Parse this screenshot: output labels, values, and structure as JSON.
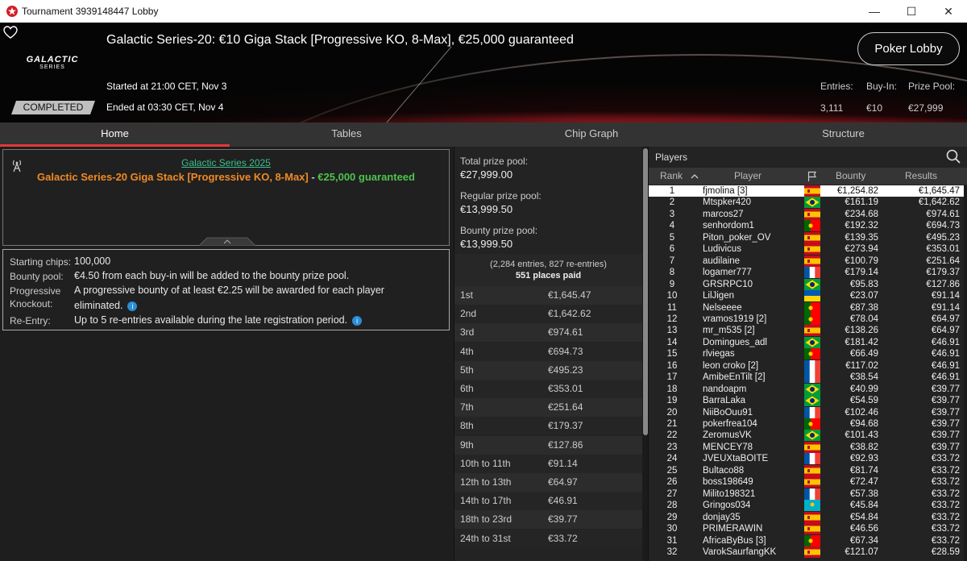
{
  "window": {
    "title": "Tournament 3939148447 Lobby",
    "minimize": "—",
    "maximize": "☐",
    "close": "✕"
  },
  "header": {
    "tournament_name": "Galactic Series-20: €10 Giga Stack [Progressive KO, 8-Max], €25,000 guaranteed",
    "brand_line1": "GALACTIC",
    "brand_line2": "SERIES",
    "status": "COMPLETED",
    "started": "Started at 21:00 CET, Nov 3",
    "ended": "Ended at 03:30 CET, Nov 4",
    "lobby_button": "Poker Lobby",
    "stats": {
      "entries_label": "Entries:",
      "buyin_label": "Buy-In:",
      "prize_label": "Prize Pool:",
      "entries": "3,111",
      "buyin": "€10",
      "prize": "€27,999"
    }
  },
  "tabs": [
    "Home",
    "Tables",
    "Chip Graph",
    "Structure"
  ],
  "info": {
    "series_link": "Galactic Series 2025",
    "event_name": "Galactic Series-20 Giga Stack [Progressive KO, 8-Max]",
    "separator": " - ",
    "guarantee": "€25,000 guaranteed"
  },
  "rules": {
    "starting_chips_label": "Starting chips:",
    "starting_chips": "100,000",
    "bounty_pool_label": "Bounty pool:",
    "bounty_pool": "€4.50 from each buy-in will be added to the bounty prize pool.",
    "pko_label_1": "Progressive",
    "pko_label_2": "Knockout:",
    "pko_1": "A progressive bounty of at least €2.25 will be awarded for each player",
    "pko_2": "eliminated.",
    "reentry_label": "Re-Entry:",
    "reentry": "Up to 5 re-entries available during the late registration period."
  },
  "prizes": {
    "total_label": "Total prize pool:",
    "total": "€27,999.00",
    "regular_label": "Regular prize pool:",
    "regular": "€13,999.50",
    "bounty_label": "Bounty prize pool:",
    "bounty": "€13,999.50",
    "entries_note": "(2,284 entries, 827 re-entries)",
    "places_paid": "551 places paid",
    "rows": [
      {
        "place": "1st",
        "amount": "€1,645.47"
      },
      {
        "place": "2nd",
        "amount": "€1,642.62"
      },
      {
        "place": "3rd",
        "amount": "€974.61"
      },
      {
        "place": "4th",
        "amount": "€694.73"
      },
      {
        "place": "5th",
        "amount": "€495.23"
      },
      {
        "place": "6th",
        "amount": "€353.01"
      },
      {
        "place": "7th",
        "amount": "€251.64"
      },
      {
        "place": "8th",
        "amount": "€179.37"
      },
      {
        "place": "9th",
        "amount": "€127.86"
      },
      {
        "place": "10th to 11th",
        "amount": "€91.14"
      },
      {
        "place": "12th to 13th",
        "amount": "€64.97"
      },
      {
        "place": "14th to 17th",
        "amount": "€46.91"
      },
      {
        "place": "18th to 23rd",
        "amount": "€39.77"
      },
      {
        "place": "24th to 31st",
        "amount": "€33.72"
      }
    ]
  },
  "players": {
    "title": "Players",
    "columns": {
      "rank": "Rank",
      "player": "Player",
      "bounty": "Bounty",
      "results": "Results"
    },
    "rows": [
      {
        "rank": "1",
        "name": "fjmolina [3]",
        "flag": "es",
        "bounty": "€1,254.82",
        "result": "€1,645.47"
      },
      {
        "rank": "2",
        "name": "Mtspker420",
        "flag": "br",
        "bounty": "€161.19",
        "result": "€1,642.62"
      },
      {
        "rank": "3",
        "name": "marcos27",
        "flag": "es",
        "bounty": "€234.68",
        "result": "€974.61"
      },
      {
        "rank": "4",
        "name": "senhordom1",
        "flag": "pt",
        "bounty": "€192.32",
        "result": "€694.73"
      },
      {
        "rank": "5",
        "name": "Piton_poker_OV",
        "flag": "es",
        "bounty": "€139.35",
        "result": "€495.23"
      },
      {
        "rank": "6",
        "name": "Ludivicus",
        "flag": "es",
        "bounty": "€273.94",
        "result": "€353.01"
      },
      {
        "rank": "7",
        "name": "audilaine",
        "flag": "es",
        "bounty": "€100.79",
        "result": "€251.64"
      },
      {
        "rank": "8",
        "name": "logamer777",
        "flag": "fr",
        "bounty": "€179.14",
        "result": "€179.37"
      },
      {
        "rank": "9",
        "name": "GRSRPC10",
        "flag": "br",
        "bounty": "€95.83",
        "result": "€127.86"
      },
      {
        "rank": "10",
        "name": "LilJigen",
        "flag": "ua",
        "bounty": "€23.07",
        "result": "€91.14"
      },
      {
        "rank": "11",
        "name": "Nelseeee",
        "flag": "pt",
        "bounty": "€87.38",
        "result": "€91.14"
      },
      {
        "rank": "12",
        "name": "vramos1919 [2]",
        "flag": "pt",
        "bounty": "€78.04",
        "result": "€64.97"
      },
      {
        "rank": "13",
        "name": "mr_m535 [2]",
        "flag": "es",
        "bounty": "€138.26",
        "result": "€64.97"
      },
      {
        "rank": "14",
        "name": "Domingues_adl",
        "flag": "br",
        "bounty": "€181.42",
        "result": "€46.91"
      },
      {
        "rank": "15",
        "name": "rlviegas",
        "flag": "pt",
        "bounty": "€66.49",
        "result": "€46.91"
      },
      {
        "rank": "16",
        "name": "leon croko [2]",
        "flag": "fr",
        "bounty": "€117.02",
        "result": "€46.91"
      },
      {
        "rank": "17",
        "name": "AmibeEnTilt [2]",
        "flag": "fr",
        "bounty": "€38.54",
        "result": "€46.91"
      },
      {
        "rank": "18",
        "name": "nandoapm",
        "flag": "br",
        "bounty": "€40.99",
        "result": "€39.77"
      },
      {
        "rank": "19",
        "name": "BarraLaka",
        "flag": "br",
        "bounty": "€54.59",
        "result": "€39.77"
      },
      {
        "rank": "20",
        "name": "NiiBoOuu91",
        "flag": "fr",
        "bounty": "€102.46",
        "result": "€39.77"
      },
      {
        "rank": "21",
        "name": "pokerfrea104",
        "flag": "pt",
        "bounty": "€94.68",
        "result": "€39.77"
      },
      {
        "rank": "22",
        "name": "ZeromusVK",
        "flag": "br",
        "bounty": "€101.43",
        "result": "€39.77"
      },
      {
        "rank": "23",
        "name": "MENCEY78",
        "flag": "es",
        "bounty": "€38.82",
        "result": "€39.77"
      },
      {
        "rank": "24",
        "name": "JVEUXtaBOITE",
        "flag": "fr",
        "bounty": "€92.93",
        "result": "€33.72"
      },
      {
        "rank": "25",
        "name": "Bultaco88",
        "flag": "es",
        "bounty": "€81.74",
        "result": "€33.72"
      },
      {
        "rank": "26",
        "name": "boss198649",
        "flag": "es",
        "bounty": "€72.47",
        "result": "€33.72"
      },
      {
        "rank": "27",
        "name": "Milito198321",
        "flag": "fr",
        "bounty": "€57.38",
        "result": "€33.72"
      },
      {
        "rank": "28",
        "name": "Gringos034",
        "flag": "kz",
        "bounty": "€45.84",
        "result": "€33.72"
      },
      {
        "rank": "29",
        "name": "donjay35",
        "flag": "es",
        "bounty": "€54.84",
        "result": "€33.72"
      },
      {
        "rank": "30",
        "name": "PRIMERAWIN",
        "flag": "es",
        "bounty": "€46.56",
        "result": "€33.72"
      },
      {
        "rank": "31",
        "name": "AfricaByBus [3]",
        "flag": "pt",
        "bounty": "€67.34",
        "result": "€33.72"
      },
      {
        "rank": "32",
        "name": "VarokSaurfangKK",
        "flag": "es",
        "bounty": "€121.07",
        "result": "€28.59"
      }
    ]
  },
  "colors": {
    "accent": "#e5383b",
    "orange": "#f08a24",
    "green": "#4ec24e",
    "link": "#3bbf8a"
  }
}
